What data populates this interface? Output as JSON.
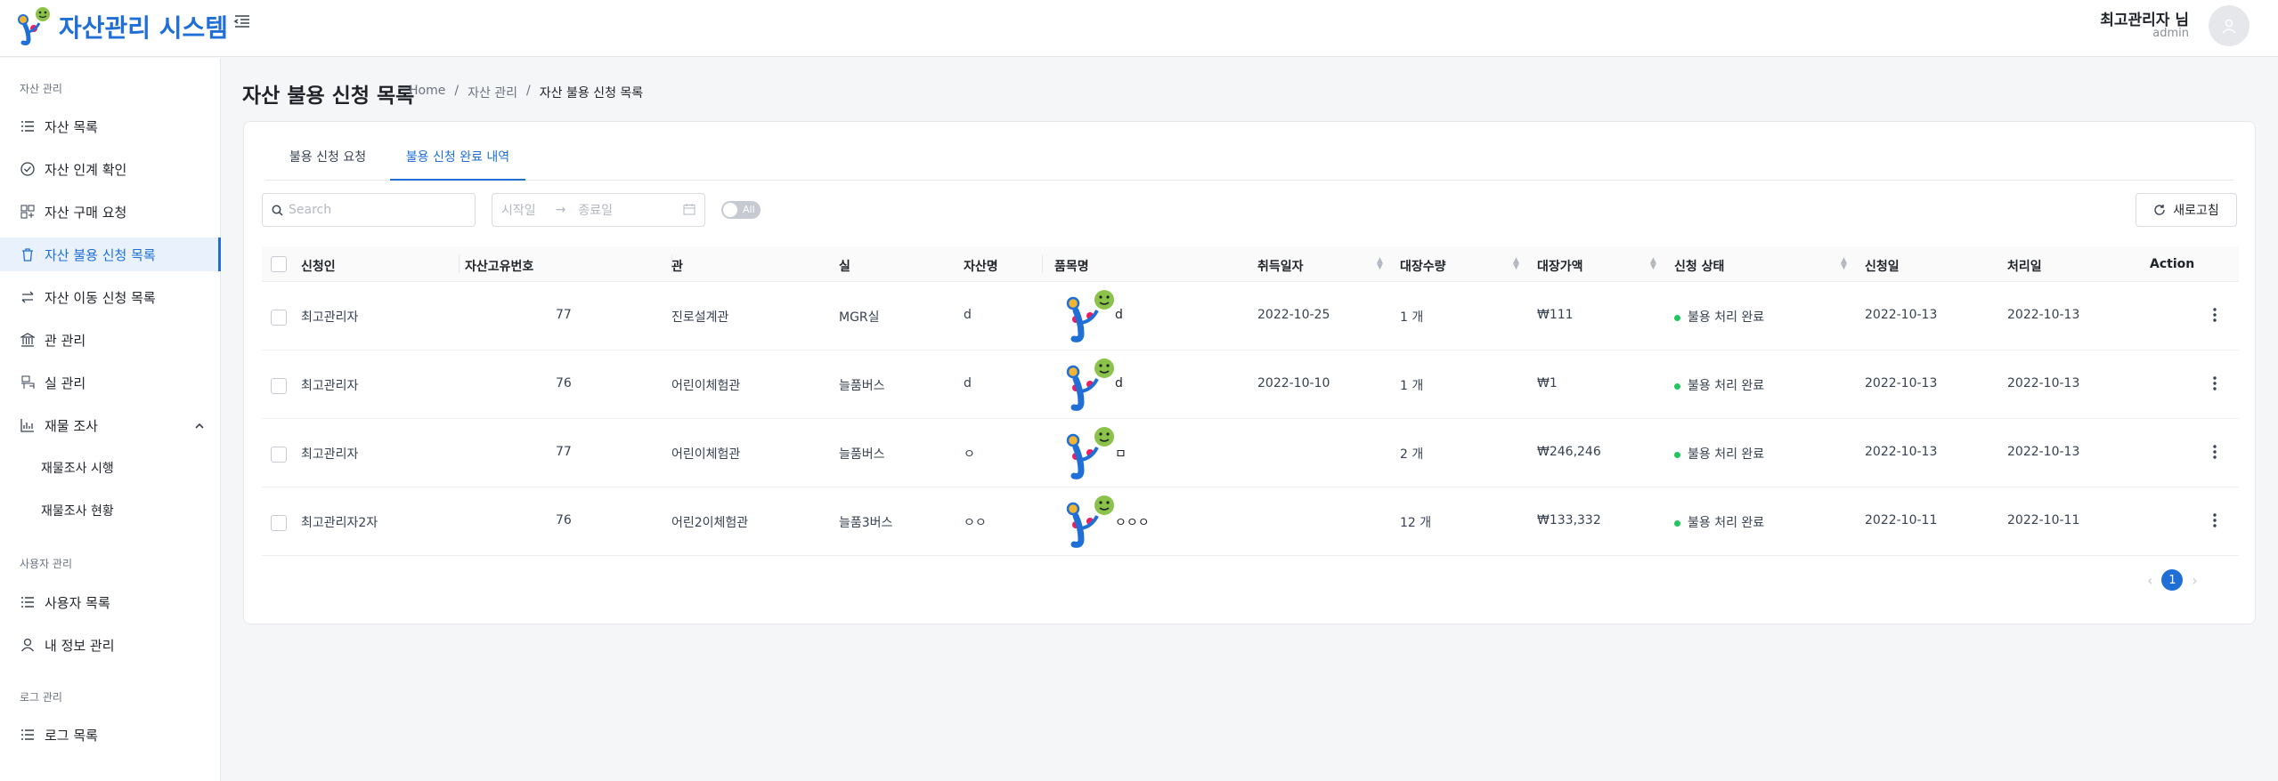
{
  "header": {
    "app_title": "자산관리 시스템",
    "user_name": "최고관리자 님",
    "user_role": "admin"
  },
  "sidebar": {
    "group_asset": "자산 관리",
    "group_user": "사용자 관리",
    "group_log": "로그 관리",
    "items": {
      "asset_list": "자산 목록",
      "asset_handover": "자산 인계 확인",
      "asset_purchase": "자산 구매 요청",
      "asset_disuse": "자산 불용 신청 목록",
      "asset_move": "자산 이동 신청 목록",
      "building": "관 관리",
      "room": "실 관리",
      "inventory": "재물 조사",
      "inventory_run": "재물조사 시행",
      "inventory_status": "재물조사 현황",
      "user_list": "사용자 목록",
      "my_info": "내 정보 관리",
      "log_list": "로그 목록"
    }
  },
  "page": {
    "title": "자산 불용 신청 목록",
    "breadcrumb": [
      "Home",
      "/",
      "자산 관리",
      "/",
      "자산 불용 신청 목록"
    ]
  },
  "tabs": [
    "불용 신청 요청",
    "불용 신청 완료 내역"
  ],
  "filters": {
    "search_placeholder": "Search",
    "start_placeholder": "시작일",
    "end_placeholder": "종료일",
    "toggle_label": "All",
    "refresh_label": "새로고침"
  },
  "table": {
    "columns": [
      "신청인",
      "자산고유번호",
      "관",
      "실",
      "자산명",
      "품목명",
      "취득일자",
      "대장수량",
      "대장가액",
      "신청 상태",
      "신청일",
      "처리일",
      "Action"
    ],
    "rows": [
      {
        "applicant": "최고관리자",
        "asset_no": "77",
        "building": "진로설계관",
        "room": "MGR실",
        "asset_name": "d",
        "item_name": "d",
        "acquired": "2022-10-25",
        "qty": "1 개",
        "value": "₩111",
        "status": "불용 처리 완료",
        "applied": "2022-10-13",
        "processed": "2022-10-13"
      },
      {
        "applicant": "최고관리자",
        "asset_no": "76",
        "building": "어린이체험관",
        "room": "늘품버스",
        "asset_name": "d",
        "item_name": "d",
        "acquired": "2022-10-10",
        "qty": "1 개",
        "value": "₩1",
        "status": "불용 처리 완료",
        "applied": "2022-10-13",
        "processed": "2022-10-13"
      },
      {
        "applicant": "최고관리자",
        "asset_no": "77",
        "building": "어린이체험관",
        "room": "늘품버스",
        "asset_name": "ㅇ",
        "item_name": "ㅁ",
        "acquired": "",
        "qty": "2 개",
        "value": "₩246,246",
        "status": "불용 처리 완료",
        "applied": "2022-10-13",
        "processed": "2022-10-13"
      },
      {
        "applicant": "최고관리자2자",
        "asset_no": "76",
        "building": "어린2이체험관",
        "room": "늘품3버스",
        "asset_name": "ㅇㅇ",
        "item_name": "ㅇㅇㅇ",
        "acquired": "",
        "qty": "12 개",
        "value": "₩133,332",
        "status": "불용 처리 완료",
        "applied": "2022-10-11",
        "processed": "2022-10-11"
      }
    ]
  },
  "pagination": {
    "current": "1"
  },
  "colors": {
    "accent": "#1f6fd6",
    "status_ok": "#22c55e"
  }
}
